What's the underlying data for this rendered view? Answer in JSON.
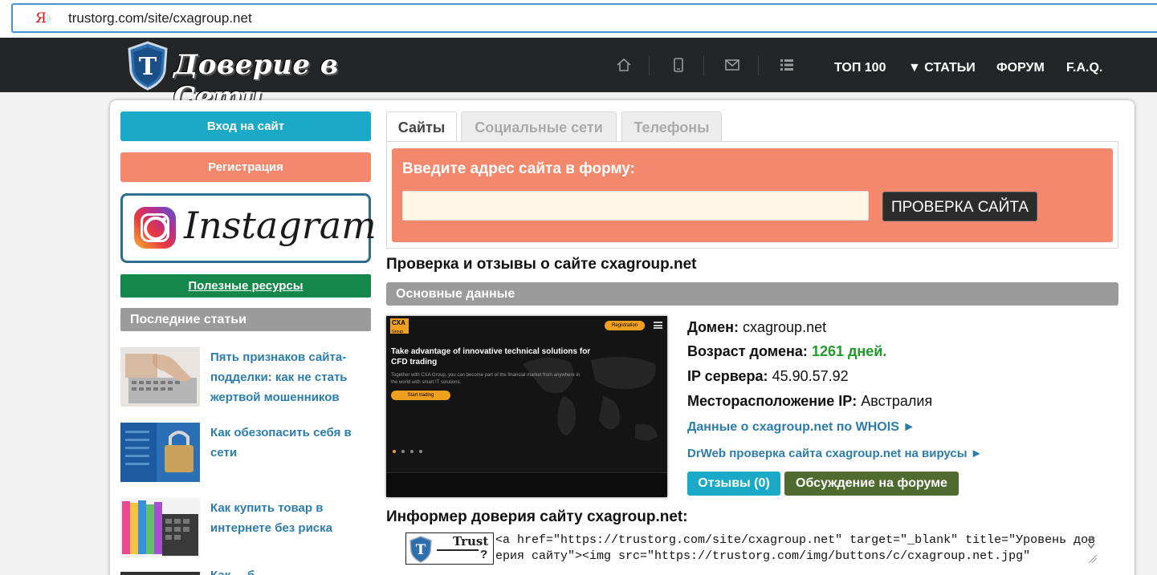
{
  "browser": {
    "url": "trustorg.com/site/cxagroup.net",
    "search_engine_icon": "yandex-icon"
  },
  "header": {
    "logo_text": "Доверие в Сети",
    "icons": [
      "home-icon",
      "mobile-icon",
      "mail-icon",
      "list-icon"
    ],
    "nav": {
      "top100": "ТОП 100",
      "articles": "▼ СТАТЬИ",
      "forum": "ФОРУМ",
      "faq": "F.A.Q."
    }
  },
  "sidebar": {
    "login": "Вход на сайт",
    "register": "Регистрация",
    "instagram": "Instagram",
    "useful": "Полезные ресурсы",
    "last_articles": "Последние статьи",
    "articles": [
      {
        "title": "Пять признаков сайта-подделки: как не стать жертвой мошенников"
      },
      {
        "title": "Как обезопасить себя в сети"
      },
      {
        "title": "Как купить товар в интернете без риска"
      },
      {
        "title": "Как ... б..."
      }
    ]
  },
  "tabs": {
    "sites": "Сайты",
    "social": "Социальные сети",
    "phones": "Телефоны"
  },
  "check": {
    "title": "Введите адрес сайта в форму:",
    "input_value": "",
    "button": "ПРОВЕРКА САЙТА"
  },
  "page": {
    "heading": "Проверка и отзывы о сайте cxagroup.net",
    "section": "Основные данные"
  },
  "preview": {
    "logo": "CXA",
    "logo_sub": "Group",
    "register": "Registration",
    "headline": "Take advantage of innovative technical solutions for CFD trading",
    "sub": "Together with CXA Group, you can become part of the financial market from anywhere in the world with smart IT solutions.",
    "cta": "Start trading"
  },
  "info": {
    "domain_label": "Домен:",
    "domain_value": "cxagroup.net",
    "age_label": "Возраст домена:",
    "age_value": "1261 дней.",
    "ip_label": "IP сервера:",
    "ip_value": "45.90.57.92",
    "location_label": "Месторасположение IP:",
    "location_value": "Австралия",
    "whois_link": "Данные о cxagroup.net по WHOIS ►",
    "drweb_link": "DrWeb проверка сайта cxagroup.net на вирусы ►",
    "reviews_button": "Отзывы (0)",
    "forum_button": "Обсуждение на форуме"
  },
  "informer": {
    "heading": "Информер доверия сайту cxagroup.net:",
    "badge_text": "Trust",
    "badge_q": "?",
    "code": "<a href=\"https://trustorg.com/site/cxagroup.net\" target=\"_blank\" title=\"Уровень доверия сайту\"><img src=\"https://trustorg.com/img/buttons/c/cxagroup.net.jpg\""
  },
  "colors": {
    "accent_blue": "#1aaac7",
    "accent_orange": "#f4886c",
    "green": "#14874a",
    "header_bg": "#232526",
    "age_green": "#1f9d25"
  }
}
